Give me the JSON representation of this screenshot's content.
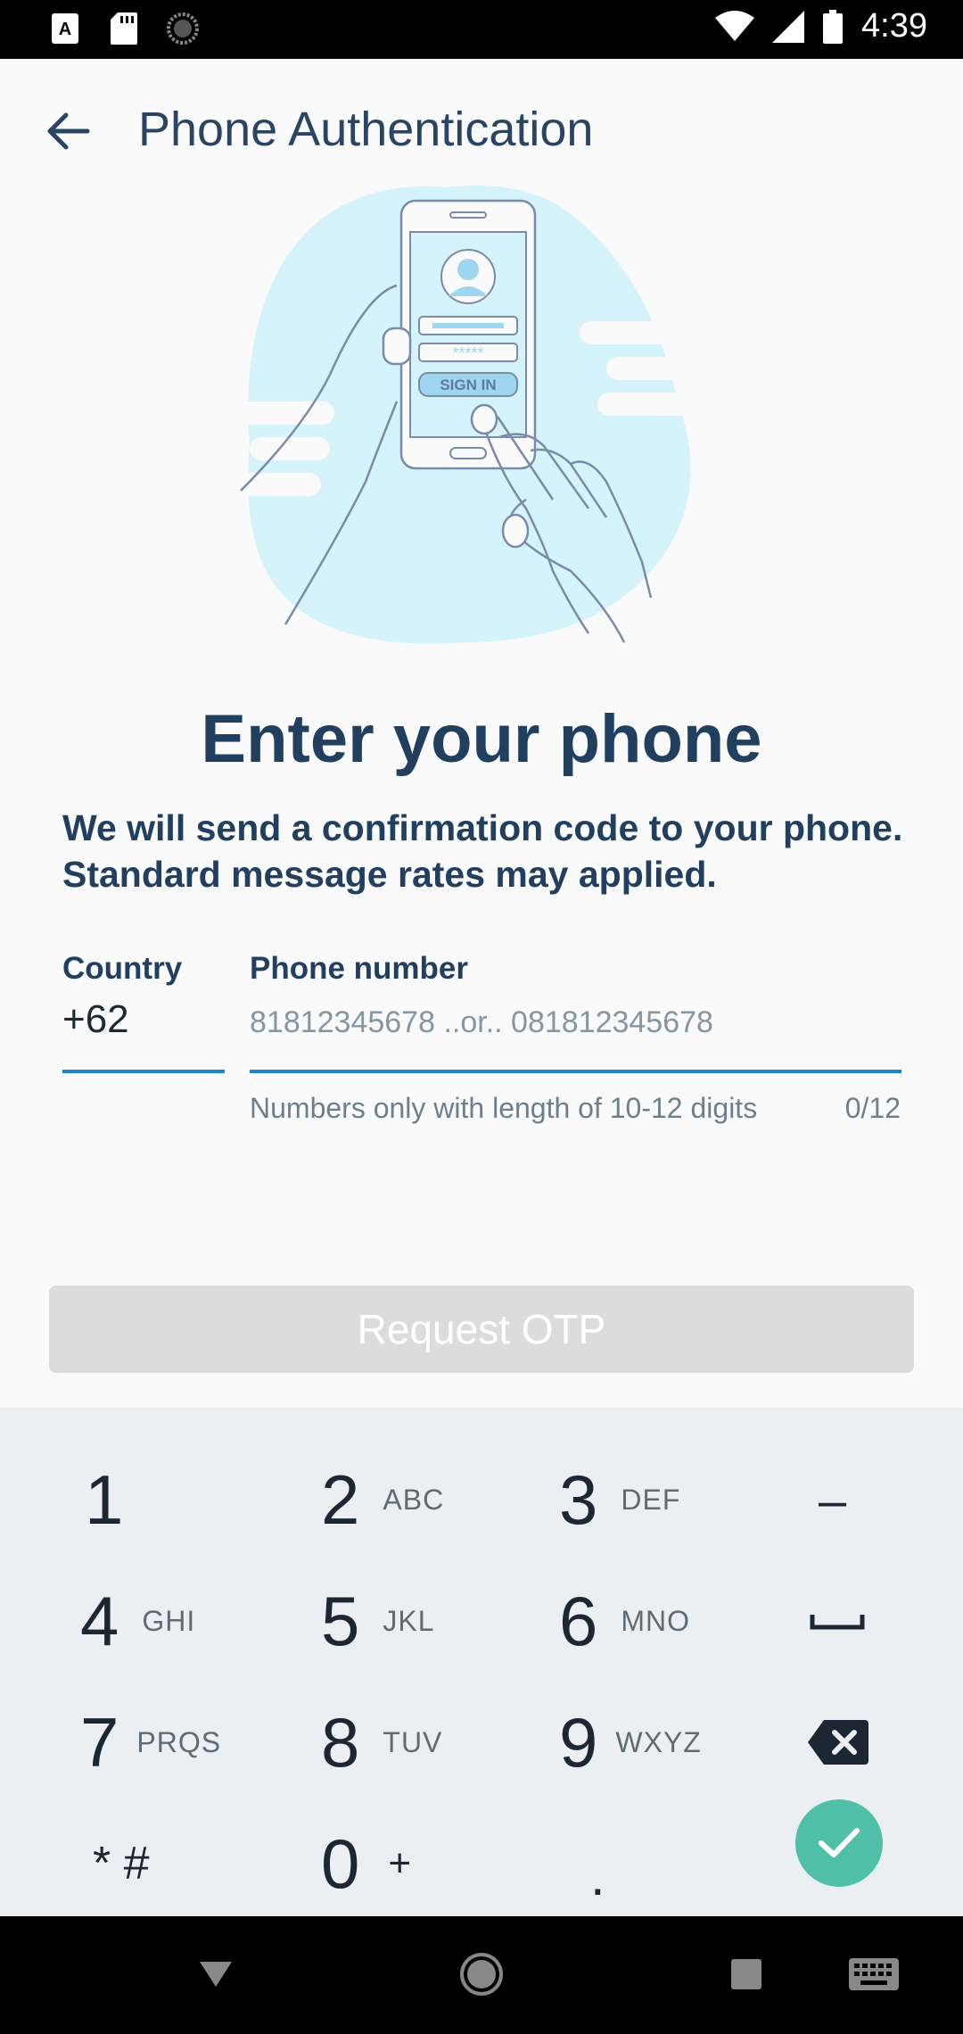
{
  "status_bar": {
    "time": "4:39",
    "icons": [
      "font-icon",
      "sd-card-icon",
      "sync-icon",
      "wifi-icon",
      "signal-icon",
      "battery-icon"
    ]
  },
  "app_bar": {
    "title": "Phone Authentication",
    "back_icon": "arrow-left-icon"
  },
  "illustration": {
    "button_text": "SIGN IN",
    "password_mask": "*****"
  },
  "content": {
    "headline": "Enter your phone",
    "subtext": "We will send a confirmation code to your phone. Standard message rates may applied."
  },
  "form": {
    "country_label": "Country",
    "country_value": "+62",
    "phone_label": "Phone number",
    "phone_value": "",
    "phone_placeholder": "81812345678 ..or.. 081812345678",
    "helper_text": "Numbers only with length of 10-12 digits",
    "counter": "0/12"
  },
  "actions": {
    "request_otp": "Request OTP"
  },
  "keypad": {
    "keys": [
      {
        "num": "1",
        "letters": ""
      },
      {
        "num": "2",
        "letters": "ABC"
      },
      {
        "num": "3",
        "letters": "DEF"
      },
      {
        "num": "–",
        "letters": ""
      },
      {
        "num": "4",
        "letters": "GHI"
      },
      {
        "num": "5",
        "letters": "JKL"
      },
      {
        "num": "6",
        "letters": "MNO"
      },
      {
        "num": "space",
        "letters": ""
      },
      {
        "num": "7",
        "letters": "PRQS"
      },
      {
        "num": "8",
        "letters": "TUV"
      },
      {
        "num": "9",
        "letters": "WXYZ"
      },
      {
        "num": "backspace",
        "letters": ""
      },
      {
        "num": "* #",
        "letters": ""
      },
      {
        "num": "0",
        "letters": "+"
      },
      {
        "num": ".",
        "letters": ""
      }
    ]
  },
  "colors": {
    "primary_text": "#213f5e",
    "accent_line": "#1e88c6",
    "done_button": "#4fbfa8",
    "disabled_button": "#dcdcdc",
    "illustration_bg": "#d4f3fb"
  },
  "nav_bar": {
    "icons": [
      "back-triangle-icon",
      "home-circle-icon",
      "recents-square-icon",
      "keyboard-icon"
    ]
  }
}
